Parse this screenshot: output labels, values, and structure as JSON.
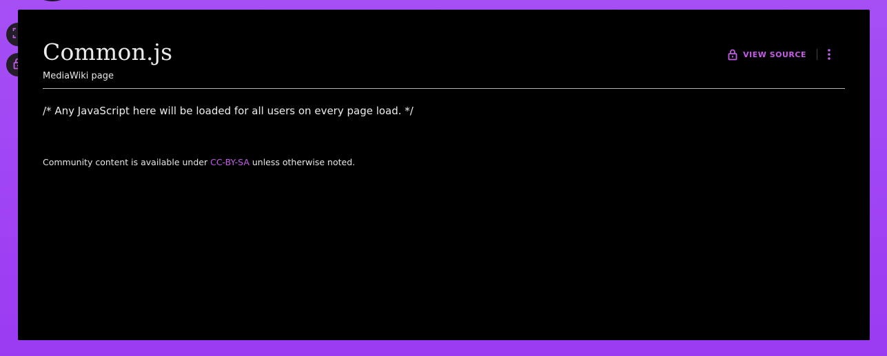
{
  "page": {
    "title": "Common.js",
    "subtitle": "MediaWiki page"
  },
  "actions": {
    "view_source_label": "VIEW SOURCE",
    "view_source_icon": "lock-icon",
    "more_icon": "more-vertical-icon"
  },
  "side_tools": [
    {
      "icon": "fullscreen-icon"
    },
    {
      "icon": "lock-icon"
    }
  ],
  "content": {
    "code": "/* Any JavaScript here will be loaded for all users on every page load. */"
  },
  "license": {
    "prefix": "Community content is available under ",
    "link_text": "CC-BY-SA",
    "suffix": " unless otherwise noted."
  },
  "colors": {
    "accent": "#c45ce8",
    "background_gradient_top": "#a64ff5",
    "panel": "#000000"
  }
}
